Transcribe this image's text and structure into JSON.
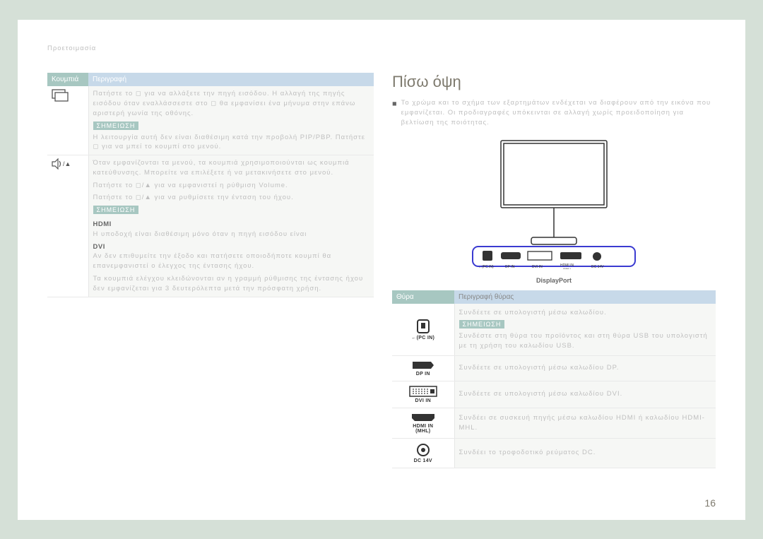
{
  "breadcrumb": "Προετοιμασία",
  "left_table": {
    "headers": [
      "Κουμπιά",
      "Περιγραφή"
    ],
    "rows": [
      {
        "icon": "source-icon",
        "text": "Πατήστε το ◻ για να αλλάξετε την πηγή εισόδου. Η αλλαγή της πηγής εισόδου όταν εναλλάσσεστε στο ◻ θα εμφανίσει ένα μήνυμα στην επάνω αριστερή γωνία της οθόνης.",
        "note_label": "ΣΗΜΕΙΩΣΗ",
        "note_text": "Η λειτουργία αυτή δεν είναι διαθέσιμη κατά την προβολή PIP/PBP. Πατήστε ◻ για να μπεί το κουμπί στο μενού."
      },
      {
        "icon": "volume-up-icon",
        "note_label": "ΣΗΜΕΙΩΣΗ",
        "line1": "Όταν εμφανίζονται τα μενού, τα κουμπιά χρησιμοποιούνται ως κουμπιά κατεύθυνσης. Μπορείτε να επιλέξετε ή να μετακινήσετε στο μενού.",
        "line2": "Πατήστε το ◻/▲ για να εμφανιστεί η ρύθμιση Volume.",
        "line3": "Πατήστε το ◻/▲ για να ρυθμίσετε την ένταση του ήχου.",
        "note_text1": "HDMI\nΗ υποδοχή είναι διαθέσιμη μόνο όταν η πηγή εισόδου είναι",
        "note_text2": "DVI\nΑν δεν επιθυμείτε την έξοδο και πατήσετε οποιοδήποτε κουμπί θα επανεμφανιστεί ο έλεγχος της έντασης ήχου.",
        "note_text3": "Τα κουμπιά ελέγχου κλειδώνονται αν η γραμμή ρύθμισης της έντασης ήχου δεν εμφανίζεται για 3 δευτερόλεπτα μετά την πρόσφατη χρήση."
      }
    ]
  },
  "right": {
    "heading": "Πίσω όψη",
    "intro": "Το χρώμα και το σχήμα των εξαρτημάτων ενδέχεται να διαφέρουν από την εικόνα που εμφανίζεται. Οι προδιαγραφές υπόκεινται σε αλλαγή χωρίς προειδοποίηση για βελτίωση της ποιότητας.",
    "dp_label": "DisplayPort",
    "port_bar_labels": [
      "PC IN",
      "DP IN",
      "DVI IN",
      "HDMI IN (MHL)",
      "DC 14V"
    ],
    "port_table": {
      "headers": [
        "Θύρα",
        "Περιγραφή θύρας"
      ],
      "rows": [
        {
          "label": "PC IN",
          "note_label": "ΣΗΜΕΙΩΣΗ",
          "text": "Συνδέετε σε υπολογιστή μέσω καλωδίου.",
          "note_text": "Συνδέστε στη θύρα του προϊόντος και στη θύρα USB του υπολογιστή με τη χρήση του καλωδίου USB."
        },
        {
          "label": "DP IN",
          "text": "Συνδέετε σε υπολογιστή μέσω καλωδίου DP."
        },
        {
          "label": "DVI IN",
          "text": "Συνδέετε σε υπολογιστή μέσω καλωδίου DVI."
        },
        {
          "label": "HDMI IN (MHL)",
          "text": "Συνδέει σε συσκευή πηγής μέσω καλωδίου HDMI ή καλωδίου HDMI-MHL."
        },
        {
          "label": "DC 14V",
          "text": "Συνδέει το τροφοδοτικό ρεύματος DC."
        }
      ]
    }
  },
  "page_number": "16"
}
